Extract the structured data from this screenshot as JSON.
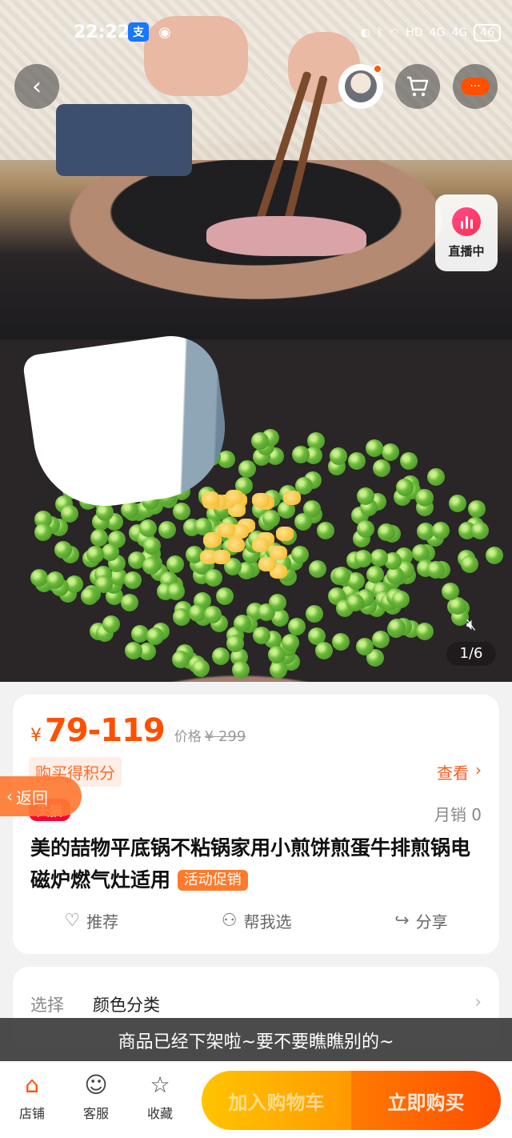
{
  "status_bar": {
    "time": "22:22",
    "battery": "46",
    "signal_labels": [
      "HD",
      "4G",
      "4G"
    ]
  },
  "live": {
    "label": "直播中"
  },
  "gallery": {
    "pager": "1/6"
  },
  "product": {
    "currency": "¥",
    "price": "79-119",
    "price_label": "价格",
    "original_price": "¥ 299",
    "points_tag": "购买得积分",
    "view_label": "查看",
    "store_tag": "天猫",
    "monthly_sales": "月销 0",
    "title": "美的喆物平底锅不粘锅家用小煎饼煎蛋牛排煎锅电磁炉燃气灶适用",
    "promo_tag": "活动促销",
    "actions": {
      "recommend": "推荐",
      "help_choose": "帮我选",
      "share": "分享"
    }
  },
  "back_float": {
    "label": "返回"
  },
  "options": {
    "label": "选择",
    "value": "颜色分类"
  },
  "toast": "商品已经下架啦~要不要瞧瞧别的~",
  "bottom_bar": {
    "shop": "店铺",
    "service": "客服",
    "favorite": "收藏",
    "add_to_cart": "加入购物车",
    "buy_now": "立即购买"
  },
  "colors": {
    "accent": "#ff5000",
    "tmall": "#ff0036",
    "cart_gradient": "#ffc400",
    "buy_gradient": "#ff4d00"
  }
}
